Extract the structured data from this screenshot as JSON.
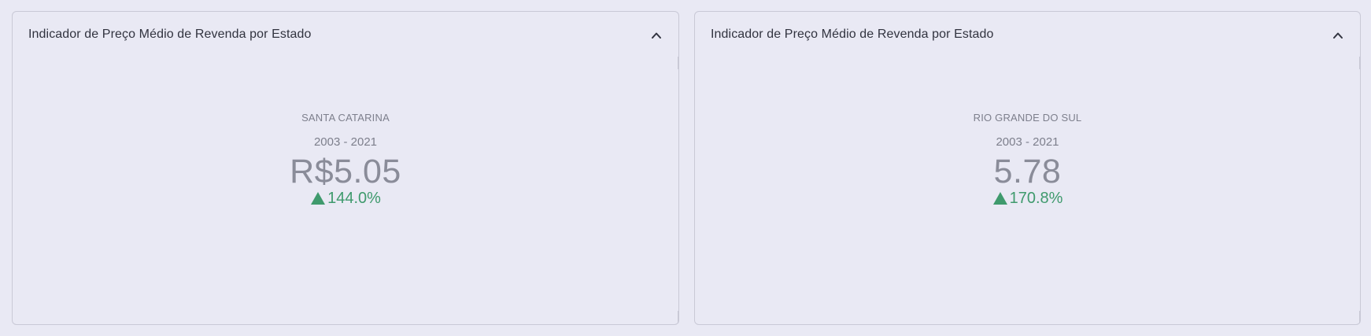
{
  "panels": [
    {
      "title": "Indicador de Preço Médio de Revenda por Estado",
      "region": "SANTA CATARINA",
      "period": "2003 - 2021",
      "value": "R$5.05",
      "delta": "144.0%",
      "delta_direction": "up",
      "delta_color": "#3f9a6d",
      "collapse_icon": "chevron-up-icon"
    },
    {
      "title": "Indicador de Preço Médio de Revenda por Estado",
      "region": "RIO GRANDE DO SUL",
      "period": "2003 - 2021",
      "value": "5.78",
      "delta": "170.8%",
      "delta_direction": "up",
      "delta_color": "#3f9a6d",
      "collapse_icon": "chevron-up-icon"
    }
  ]
}
